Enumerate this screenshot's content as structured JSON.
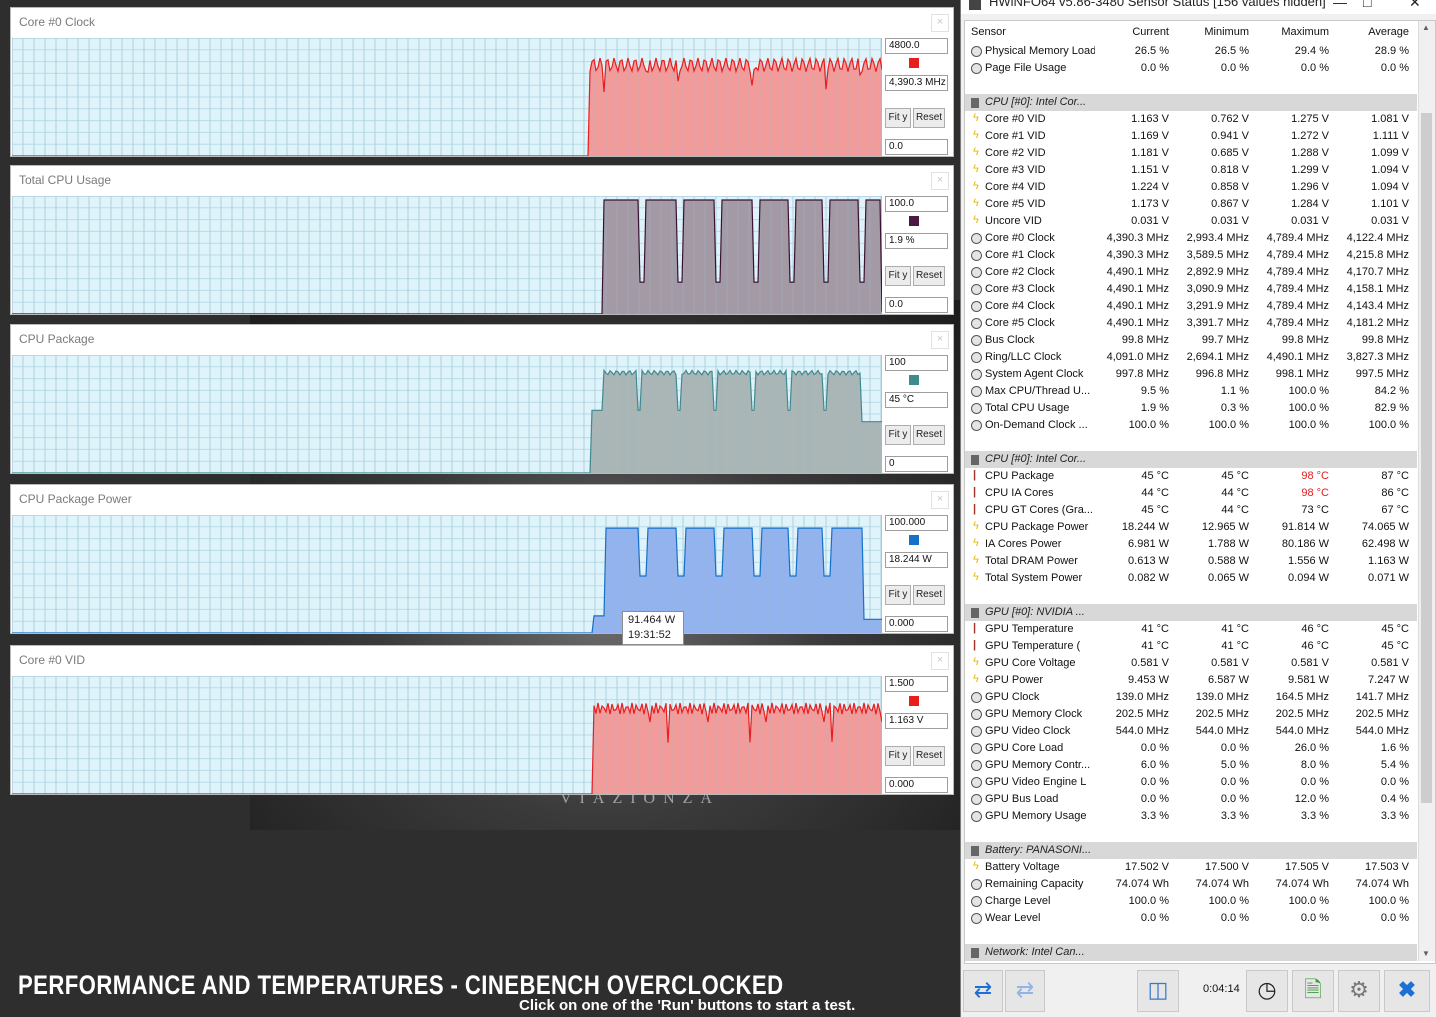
{
  "graphs": [
    {
      "title": "Core #0 Clock",
      "max": "4800.0",
      "current": "4,390.3 MHz",
      "min": "0.0",
      "fit": "Fit y",
      "reset": "Reset",
      "swatch": "#e81d1d",
      "fill": "#f29b9b",
      "line": "#e81d1d"
    },
    {
      "title": "Total CPU Usage",
      "max": "100.0",
      "current": "1.9 %",
      "min": "0.0",
      "fit": "Fit y",
      "reset": "Reset",
      "swatch": "#4b1941",
      "fill": "#a49aa5",
      "line": "#3b1133"
    },
    {
      "title": "CPU Package",
      "max": "100",
      "current": "45 °C",
      "min": "0",
      "fit": "Fit y",
      "reset": "Reset",
      "swatch": "#3f8a8f",
      "fill": "#aab6b6",
      "line": "#3f8a8f"
    },
    {
      "title": "CPU Package Power",
      "max": "100.000",
      "current": "18.244 W",
      "min": "0.000",
      "fit": "Fit y",
      "reset": "Reset",
      "swatch": "#1570c8",
      "fill": "#93b3ee",
      "line": "#1570c8"
    },
    {
      "title": "Core #0 VID",
      "max": "1.500",
      "current": "1.163 V",
      "min": "0.000",
      "fit": "Fit y",
      "reset": "Reset",
      "swatch": "#e81d1d",
      "fill": "#f29b9b",
      "line": "#e81d1d"
    }
  ],
  "tooltip": {
    "value": "91.464 W",
    "time": "19:31:52"
  },
  "hwinfo": {
    "title": "HWiNFO64 v5.86-3480 Sensor Status [156 values hidden]",
    "headers": [
      "Sensor",
      "Current",
      "Minimum",
      "Maximum",
      "Average"
    ],
    "rows": [
      {
        "t": "row",
        "icon": "circle",
        "name": "Physical Memory Load",
        "v": [
          "26.5 %",
          "26.5 %",
          "29.4 %",
          "28.9 %"
        ]
      },
      {
        "t": "row",
        "icon": "circle",
        "name": "Page File Usage",
        "v": [
          "0.0 %",
          "0.0 %",
          "0.0 %",
          "0.0 %"
        ]
      },
      {
        "t": "gap"
      },
      {
        "t": "grp",
        "name": "CPU [#0]: Intel Cor..."
      },
      {
        "t": "row",
        "icon": "bolt",
        "name": "Core #0 VID",
        "v": [
          "1.163 V",
          "0.762 V",
          "1.275 V",
          "1.081 V"
        ]
      },
      {
        "t": "row",
        "icon": "bolt",
        "name": "Core #1 VID",
        "v": [
          "1.169 V",
          "0.941 V",
          "1.272 V",
          "1.111 V"
        ]
      },
      {
        "t": "row",
        "icon": "bolt",
        "name": "Core #2 VID",
        "v": [
          "1.181 V",
          "0.685 V",
          "1.288 V",
          "1.099 V"
        ]
      },
      {
        "t": "row",
        "icon": "bolt",
        "name": "Core #3 VID",
        "v": [
          "1.151 V",
          "0.818 V",
          "1.299 V",
          "1.094 V"
        ]
      },
      {
        "t": "row",
        "icon": "bolt",
        "name": "Core #4 VID",
        "v": [
          "1.224 V",
          "0.858 V",
          "1.296 V",
          "1.094 V"
        ]
      },
      {
        "t": "row",
        "icon": "bolt",
        "name": "Core #5 VID",
        "v": [
          "1.173 V",
          "0.867 V",
          "1.284 V",
          "1.101 V"
        ]
      },
      {
        "t": "row",
        "icon": "bolt",
        "name": "Uncore VID",
        "v": [
          "0.031 V",
          "0.031 V",
          "0.031 V",
          "0.031 V"
        ]
      },
      {
        "t": "row",
        "icon": "circle",
        "name": "Core #0 Clock",
        "v": [
          "4,390.3 MHz",
          "2,993.4 MHz",
          "4,789.4 MHz",
          "4,122.4 MHz"
        ]
      },
      {
        "t": "row",
        "icon": "circle",
        "name": "Core #1 Clock",
        "v": [
          "4,390.3 MHz",
          "3,589.5 MHz",
          "4,789.4 MHz",
          "4,215.8 MHz"
        ]
      },
      {
        "t": "row",
        "icon": "circle",
        "name": "Core #2 Clock",
        "v": [
          "4,490.1 MHz",
          "2,892.9 MHz",
          "4,789.4 MHz",
          "4,170.7 MHz"
        ]
      },
      {
        "t": "row",
        "icon": "circle",
        "name": "Core #3 Clock",
        "v": [
          "4,490.1 MHz",
          "3,090.9 MHz",
          "4,789.4 MHz",
          "4,158.1 MHz"
        ]
      },
      {
        "t": "row",
        "icon": "circle",
        "name": "Core #4 Clock",
        "v": [
          "4,490.1 MHz",
          "3,291.9 MHz",
          "4,789.4 MHz",
          "4,143.4 MHz"
        ]
      },
      {
        "t": "row",
        "icon": "circle",
        "name": "Core #5 Clock",
        "v": [
          "4,490.1 MHz",
          "3,391.7 MHz",
          "4,789.4 MHz",
          "4,181.2 MHz"
        ]
      },
      {
        "t": "row",
        "icon": "circle",
        "name": "Bus Clock",
        "v": [
          "99.8 MHz",
          "99.7 MHz",
          "99.8 MHz",
          "99.8 MHz"
        ]
      },
      {
        "t": "row",
        "icon": "circle",
        "name": "Ring/LLC Clock",
        "v": [
          "4,091.0 MHz",
          "2,694.1 MHz",
          "4,490.1 MHz",
          "3,827.3 MHz"
        ]
      },
      {
        "t": "row",
        "icon": "circle",
        "name": "System Agent Clock",
        "v": [
          "997.8 MHz",
          "996.8 MHz",
          "998.1 MHz",
          "997.5 MHz"
        ]
      },
      {
        "t": "row",
        "icon": "circle",
        "name": "Max CPU/Thread U...",
        "v": [
          "9.5 %",
          "1.1 %",
          "100.0 %",
          "84.2 %"
        ]
      },
      {
        "t": "row",
        "icon": "circle",
        "name": "Total CPU Usage",
        "v": [
          "1.9 %",
          "0.3 %",
          "100.0 %",
          "82.9 %"
        ]
      },
      {
        "t": "row",
        "icon": "circle",
        "name": "On-Demand Clock ...",
        "v": [
          "100.0 %",
          "100.0 %",
          "100.0 %",
          "100.0 %"
        ]
      },
      {
        "t": "gap"
      },
      {
        "t": "grp",
        "name": "CPU [#0]: Intel Cor..."
      },
      {
        "t": "row",
        "icon": "therm",
        "name": "CPU Package",
        "v": [
          "45 °C",
          "45 °C",
          "98 °C",
          "87 °C"
        ],
        "red": 2
      },
      {
        "t": "row",
        "icon": "therm",
        "name": "CPU IA Cores",
        "v": [
          "44 °C",
          "44 °C",
          "98 °C",
          "86 °C"
        ],
        "red": 2
      },
      {
        "t": "row",
        "icon": "therm",
        "name": "CPU GT Cores (Gra...",
        "v": [
          "45 °C",
          "44 °C",
          "73 °C",
          "67 °C"
        ]
      },
      {
        "t": "row",
        "icon": "bolt",
        "name": "CPU Package Power",
        "v": [
          "18.244 W",
          "12.965 W",
          "91.814 W",
          "74.065 W"
        ]
      },
      {
        "t": "row",
        "icon": "bolt",
        "name": "IA Cores Power",
        "v": [
          "6.981 W",
          "1.788 W",
          "80.186 W",
          "62.498 W"
        ]
      },
      {
        "t": "row",
        "icon": "bolt",
        "name": "Total DRAM Power",
        "v": [
          "0.613 W",
          "0.588 W",
          "1.556 W",
          "1.163 W"
        ]
      },
      {
        "t": "row",
        "icon": "bolt",
        "name": "Total System Power",
        "v": [
          "0.082 W",
          "0.065 W",
          "0.094 W",
          "0.071 W"
        ]
      },
      {
        "t": "gap"
      },
      {
        "t": "grp",
        "name": "GPU [#0]: NVIDIA ..."
      },
      {
        "t": "row",
        "icon": "therm",
        "name": "GPU Temperature",
        "v": [
          "41 °C",
          "41 °C",
          "46 °C",
          "45 °C"
        ]
      },
      {
        "t": "row",
        "icon": "therm",
        "name": "GPU Temperature (",
        "v": [
          "41 °C",
          "41 °C",
          "46 °C",
          "45 °C"
        ]
      },
      {
        "t": "row",
        "icon": "bolt",
        "name": "GPU Core Voltage",
        "v": [
          "0.581 V",
          "0.581 V",
          "0.581 V",
          "0.581 V"
        ]
      },
      {
        "t": "row",
        "icon": "bolt",
        "name": "GPU Power",
        "v": [
          "9.453 W",
          "6.587 W",
          "9.581 W",
          "7.247 W"
        ]
      },
      {
        "t": "row",
        "icon": "circle",
        "name": "GPU Clock",
        "v": [
          "139.0 MHz",
          "139.0 MHz",
          "164.5 MHz",
          "141.7 MHz"
        ]
      },
      {
        "t": "row",
        "icon": "circle",
        "name": "GPU Memory Clock",
        "v": [
          "202.5 MHz",
          "202.5 MHz",
          "202.5 MHz",
          "202.5 MHz"
        ]
      },
      {
        "t": "row",
        "icon": "circle",
        "name": "GPU Video Clock",
        "v": [
          "544.0 MHz",
          "544.0 MHz",
          "544.0 MHz",
          "544.0 MHz"
        ]
      },
      {
        "t": "row",
        "icon": "circle",
        "name": "GPU Core Load",
        "v": [
          "0.0 %",
          "0.0 %",
          "26.0 %",
          "1.6 %"
        ]
      },
      {
        "t": "row",
        "icon": "circle",
        "name": "GPU Memory Contr...",
        "v": [
          "6.0 %",
          "5.0 %",
          "8.0 %",
          "5.4 %"
        ]
      },
      {
        "t": "row",
        "icon": "circle",
        "name": "GPU Video Engine L",
        "v": [
          "0.0 %",
          "0.0 %",
          "0.0 %",
          "0.0 %"
        ]
      },
      {
        "t": "row",
        "icon": "circle",
        "name": "GPU Bus Load",
        "v": [
          "0.0 %",
          "0.0 %",
          "12.0 %",
          "0.4 %"
        ]
      },
      {
        "t": "row",
        "icon": "circle",
        "name": "GPU Memory Usage",
        "v": [
          "3.3 %",
          "3.3 %",
          "3.3 %",
          "3.3 %"
        ]
      },
      {
        "t": "gap"
      },
      {
        "t": "grp",
        "name": "Battery: PANASONI..."
      },
      {
        "t": "row",
        "icon": "bolt",
        "name": "Battery Voltage",
        "v": [
          "17.502 V",
          "17.500 V",
          "17.505 V",
          "17.503 V"
        ]
      },
      {
        "t": "row",
        "icon": "circle",
        "name": "Remaining Capacity",
        "v": [
          "74.074 Wh",
          "74.074 Wh",
          "74.074 Wh",
          "74.074 Wh"
        ]
      },
      {
        "t": "row",
        "icon": "circle",
        "name": "Charge Level",
        "v": [
          "100.0 %",
          "100.0 %",
          "100.0 %",
          "100.0 %"
        ]
      },
      {
        "t": "row",
        "icon": "circle",
        "name": "Wear Level",
        "v": [
          "0.0 %",
          "0.0 %",
          "0.0 %",
          "0.0 %"
        ]
      },
      {
        "t": "gap"
      },
      {
        "t": "grp",
        "name": "Network: Intel Can..."
      }
    ],
    "timer": "0:04:14"
  },
  "caption": "PERFORMANCE AND TEMPERATURES - CINEBENCH OVERCLOCKED",
  "subcaption": "Click on one of the 'Run' buttons to start a test.",
  "wallpaper_text": "VIAZIONZA"
}
